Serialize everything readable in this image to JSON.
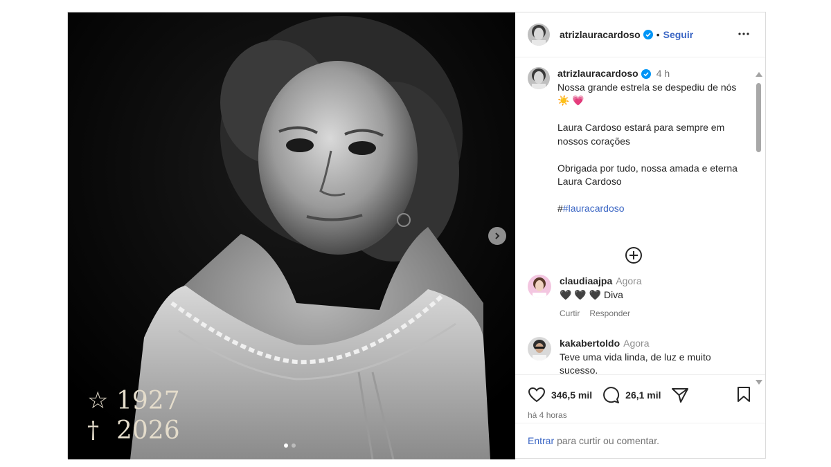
{
  "post": {
    "username": "atrizlauracardoso",
    "follow_label": "Seguir",
    "separator": "•",
    "caption": {
      "time": "4 h",
      "line1": "Nossa grande estrela se despediu de nós ☀️ 💗",
      "line2": "Laura Cardoso estará para sempre em nossos corações",
      "line3": "Obrigada por tudo, nossa amada e eterna Laura Cardoso",
      "hashtag_prefix": "#",
      "hashtag": "#lauracardoso"
    },
    "image": {
      "birth_symbol": "☆",
      "birth_year": "1927",
      "death_symbol": "†",
      "death_year": "2026",
      "slide_count": 2,
      "active_slide": 1
    }
  },
  "comments": [
    {
      "user": "claudiaajpa",
      "time": "Agora",
      "text": "🖤 🖤 🖤 Diva",
      "like_label": "Curtir",
      "reply_label": "Responder"
    },
    {
      "user": "kakabertoldo",
      "time": "Agora",
      "text": "Teve uma vida linda, de luz e muito sucesso."
    }
  ],
  "actions": {
    "likes": "346,5 mil",
    "comments": "26,1 mil",
    "posted": "há 4 horas"
  },
  "login": {
    "link": "Entrar",
    "text": "para curtir ou comentar."
  },
  "colors": {
    "link": "#3b66c4",
    "verified": "#0095f6",
    "muted": "#737373"
  }
}
